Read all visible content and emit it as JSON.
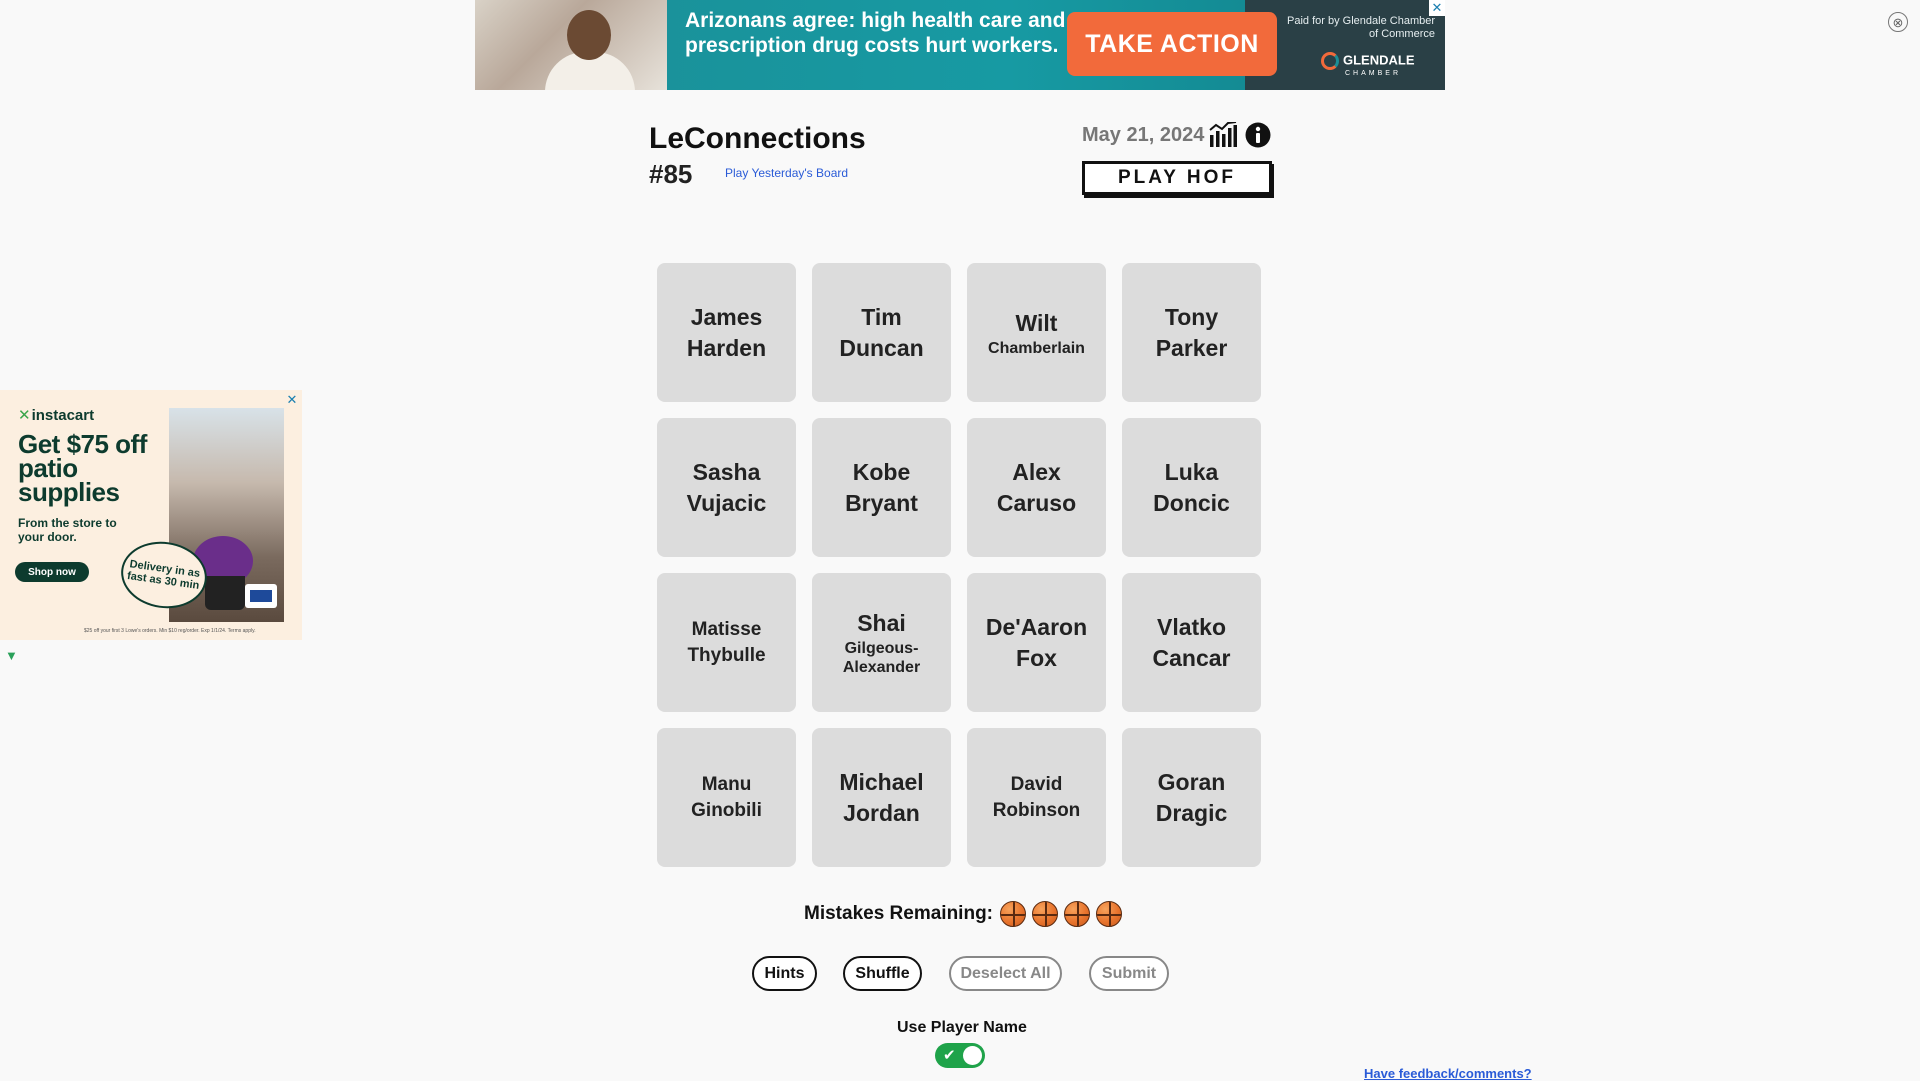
{
  "top_ad": {
    "headline": "Arizonans agree: high health care and prescription drug costs hurt workers.",
    "cta": "TAKE ACTION",
    "paid_by": "Paid for by Glendale Chamber of Commerce",
    "brand": "GLENDALE",
    "brand_sub": "CHAMBER",
    "close": "✕"
  },
  "page_close": "⊗",
  "header": {
    "title": "LeConnections",
    "puzzle_number": "#85",
    "yesterday_link": "Play Yesterday's Board",
    "date": "May 21, 2024",
    "play_hof": "PLAY HOF"
  },
  "tiles": [
    {
      "first": "James",
      "last": "Harden",
      "size": "big"
    },
    {
      "first": "Tim",
      "last": "Duncan",
      "size": "big"
    },
    {
      "first": "Wilt",
      "last": "Chamberlain",
      "size": "mixed"
    },
    {
      "first": "Tony",
      "last": "Parker",
      "size": "big"
    },
    {
      "first": "Sasha",
      "last": "Vujacic",
      "size": "big"
    },
    {
      "first": "Kobe",
      "last": "Bryant",
      "size": "big"
    },
    {
      "first": "Alex",
      "last": "Caruso",
      "size": "big"
    },
    {
      "first": "Luka",
      "last": "Doncic",
      "size": "big"
    },
    {
      "first": "Matisse",
      "last": "Thybulle",
      "size": "med"
    },
    {
      "first": "Shai",
      "last": "Gilgeous-Alexander",
      "size": "mixed"
    },
    {
      "first": "De'Aaron",
      "last": "Fox",
      "size": "big"
    },
    {
      "first": "Vlatko",
      "last": "Cancar",
      "size": "big"
    },
    {
      "first": "Manu",
      "last": "Ginobili",
      "size": "med"
    },
    {
      "first": "Michael",
      "last": "Jordan",
      "size": "big"
    },
    {
      "first": "David",
      "last": "Robinson",
      "size": "med"
    },
    {
      "first": "Goran",
      "last": "Dragic",
      "size": "big"
    }
  ],
  "mistakes": {
    "label": "Mistakes Remaining:",
    "remaining": 4
  },
  "buttons": {
    "hints": "Hints",
    "shuffle": "Shuffle",
    "deselect_all": "Deselect All",
    "submit": "Submit"
  },
  "toggle": {
    "label": "Use Player Name",
    "on": true
  },
  "feedback_link": "Have feedback/comments?",
  "side_ad": {
    "brand": "instacart",
    "headline": "Get $75 off patio supplies",
    "sub": "From the store to your door.",
    "shop": "Shop now",
    "badge": "Delivery in as fast as 30 min",
    "fine_print": "$25 off your first 3 Lowe's orders. Min $10 reg/order. Exp 1/1/24. Terms apply.",
    "close": "✕"
  },
  "colors": {
    "background": "#f9f9f9",
    "tile": "#dcdcdc",
    "link": "#2a5bd7",
    "toggle_on": "#1fa34a",
    "ad_teal": "#179aa3",
    "ad_cta": "#f26a3b"
  }
}
